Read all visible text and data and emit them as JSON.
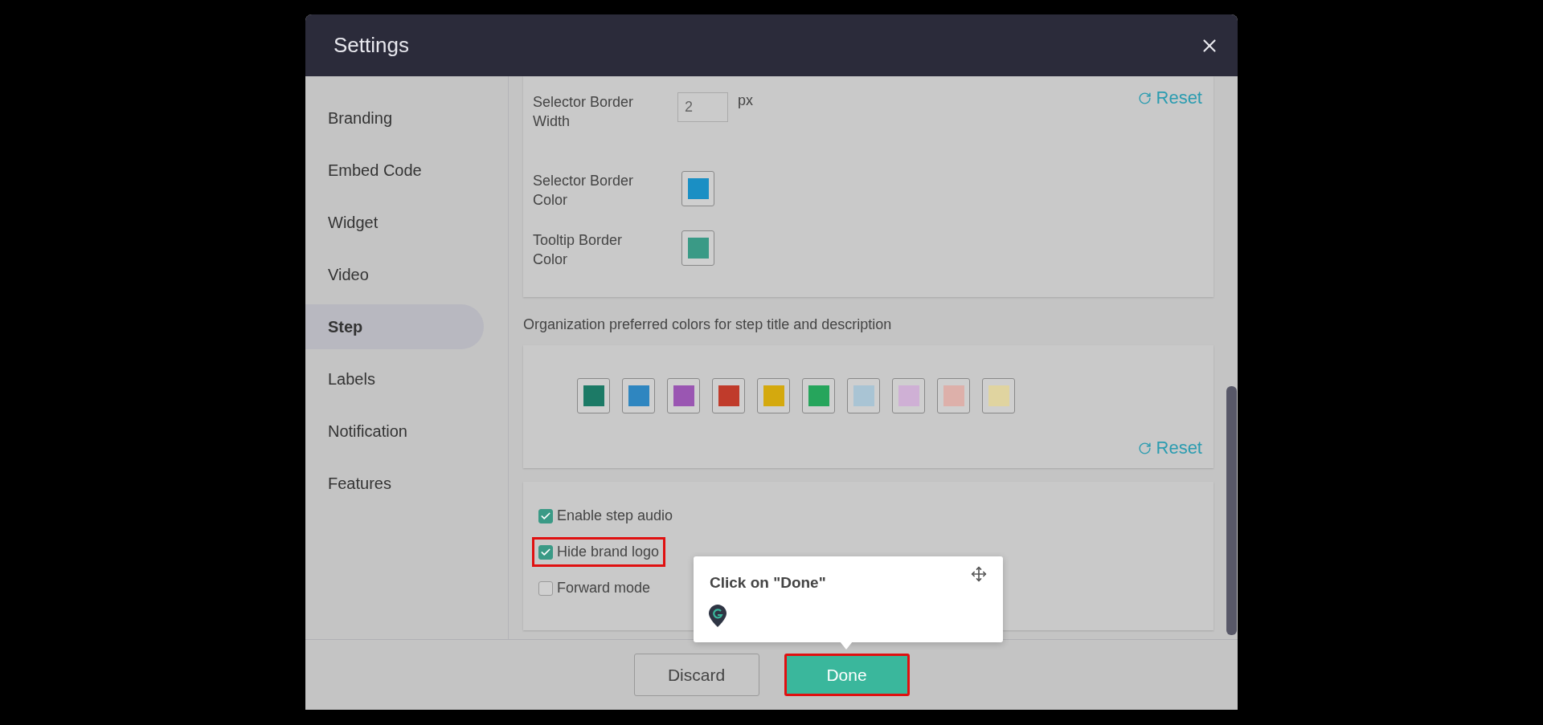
{
  "dialog": {
    "title": "Settings"
  },
  "sidebar": {
    "items": [
      {
        "label": "Branding",
        "selected": false
      },
      {
        "label": "Embed Code",
        "selected": false
      },
      {
        "label": "Widget",
        "selected": false
      },
      {
        "label": "Video",
        "selected": false
      },
      {
        "label": "Step",
        "selected": true
      },
      {
        "label": "Labels",
        "selected": false
      },
      {
        "label": "Notification",
        "selected": false
      },
      {
        "label": "Features",
        "selected": false
      }
    ]
  },
  "border_settings": {
    "fields": [
      {
        "kind": "number",
        "label": "Selector Border Width",
        "value": "2",
        "unit": "px"
      },
      {
        "kind": "color",
        "label": "Selector Border Color",
        "color": "#1a8fc4"
      },
      {
        "kind": "color",
        "label": "Tooltip Border Color",
        "color": "#3a9a86"
      }
    ],
    "reset": "Reset"
  },
  "palette": {
    "caption": "Organization preferred colors for step title and description",
    "swatches": [
      {
        "color": "#1c7a66"
      },
      {
        "color": "#2f86c0"
      },
      {
        "color": "#9a56b2"
      },
      {
        "color": "#c03b2b"
      },
      {
        "color": "#d4a90e"
      },
      {
        "color": "#26a55c"
      },
      {
        "color": "#a9c4d4"
      },
      {
        "color": "#cfb0d5"
      },
      {
        "color": "#ddb0aa"
      },
      {
        "color": "#e0d4a0"
      }
    ],
    "reset": "Reset"
  },
  "options": [
    {
      "label": "Enable step audio",
      "checked": true,
      "highlighted": false
    },
    {
      "label": "Hide brand logo",
      "checked": true,
      "highlighted": true
    },
    {
      "label": "Forward mode",
      "checked": false,
      "highlighted": false
    }
  ],
  "footer": {
    "buttons": [
      {
        "kind": "secondary",
        "label": "Discard",
        "highlighted": false
      },
      {
        "kind": "primary",
        "label": "Done",
        "highlighted": true
      }
    ]
  },
  "guide_tooltip": {
    "text": "Click on \"Done\""
  }
}
